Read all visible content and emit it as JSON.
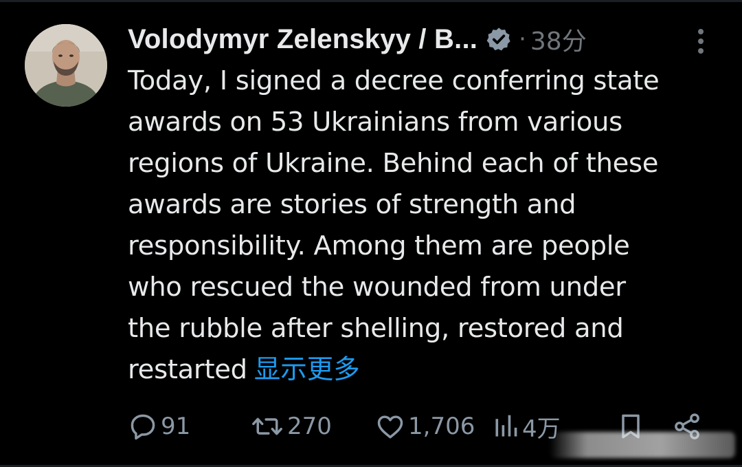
{
  "post": {
    "author_name": "Volodymyr Zelenskyy / B...",
    "separator": "·",
    "time": "38分",
    "text": "Today, I signed a decree conferring state\nawards on 53 Ukrainians from various\nregions of Ukraine. Behind each of these\nawards are stories of strength and\nresponsibility. Among them are people\nwho rescued the wounded from under\nthe rubble after shelling, restored and\nrestarted",
    "show_more": "显示更多"
  },
  "actions": {
    "replies": "91",
    "reposts": "270",
    "likes": "1,706",
    "views": "4万"
  },
  "colors": {
    "background": "#000000",
    "text": "#e7e9ea",
    "muted": "#71767b",
    "link": "#1d9bf0"
  },
  "icons": {
    "more": "more-vertical-icon",
    "verified": "verified-badge-icon",
    "reply": "reply-icon",
    "repost": "repost-icon",
    "like": "heart-icon",
    "views": "bar-chart-icon",
    "bookmark": "bookmark-icon",
    "share": "share-icon"
  }
}
